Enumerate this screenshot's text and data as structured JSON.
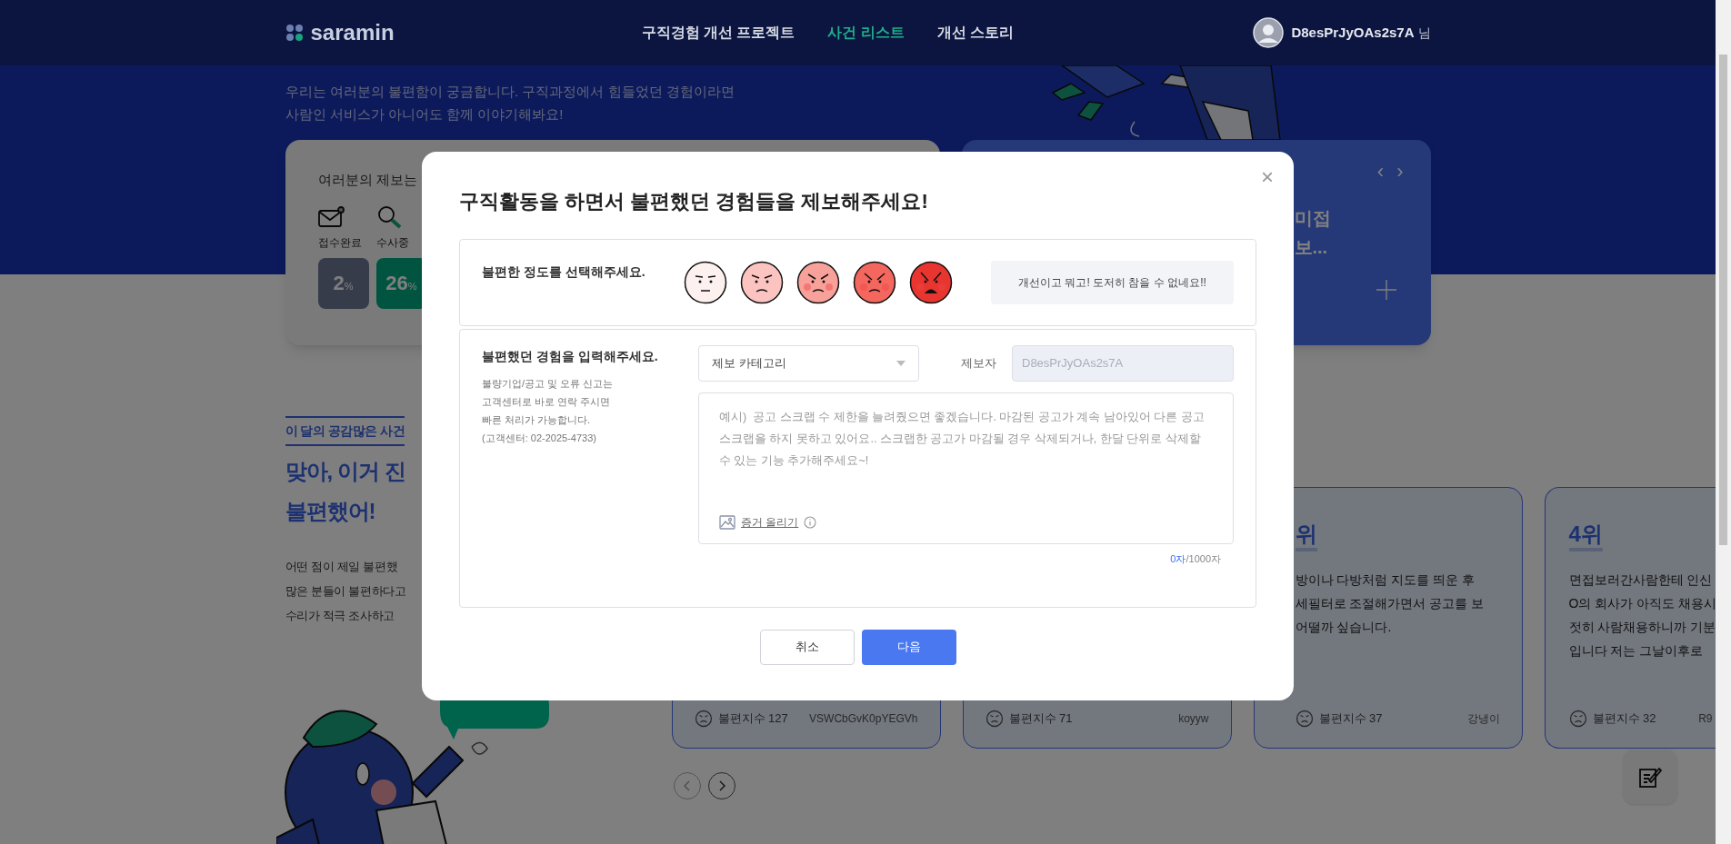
{
  "header": {
    "logo": "saramin",
    "nav": [
      {
        "label": "구직경험 개선 프로젝트",
        "selected": false
      },
      {
        "label": "사건 리스트",
        "selected": true
      },
      {
        "label": "개선 스토리",
        "selected": false
      }
    ],
    "user": {
      "name": "D8esPrJyOAs2s7A",
      "suffix": "님"
    }
  },
  "hero": {
    "lines": [
      "우리는 여러분의 불편함이 궁금합니다. 구직과정에서 힘들었던 경험이라면",
      "사람인 서비스가 아니어도 함께 이야기해봐요!"
    ]
  },
  "report_card": {
    "title": "여러분의 제보는",
    "stats": [
      {
        "kind": "received",
        "label": "접수완료",
        "value": "2",
        "unit": "%"
      },
      {
        "kind": "investigating",
        "label": "수사중",
        "value": "26",
        "unit": "%"
      }
    ]
  },
  "story_card": {
    "prev": "‹",
    "next": "›",
    "title_lines": [
      "미접",
      "보..."
    ]
  },
  "monthly": {
    "tag": "이 달의 공감많은 사건",
    "heading_lines": [
      "맞아, 이거 진",
      "불편했어!"
    ],
    "paragraph_lines": [
      "어떤 점이 제일 불편했",
      "많은 분들이 불편하다고",
      "수리가 적극 조사하고"
    ]
  },
  "cases": [
    {
      "score": "불편지수 127",
      "author": "VSWCbGvK0pYEGVh"
    },
    {
      "score": "불편지수 71",
      "author": "koyyw"
    },
    {
      "rank": "위",
      "lines": [
        "방이나 다방처럼 지도를 띄운 후",
        "세필터로 조절해가면서 공고를 보",
        "어떨까 싶습니다."
      ],
      "score": "불편지수 37",
      "author": "강냉이"
    },
    {
      "rank": "4위",
      "lines": [
        "면접보러간사람한테 인신",
        "O의 회사가 아직도 채용시",
        "젓히 사람채용하니까 기분",
        "입니다 저는 그날이후로"
      ],
      "score": "불편지수 32",
      "author": "R9"
    }
  ],
  "modal": {
    "title": "구직활동을 하면서 불편했던 경험들을 제보해주세요!",
    "close": "×",
    "severity": {
      "label": "불편한 정도를 선택해주세요.",
      "faces": [
        {
          "color": "#fdf1ef"
        },
        {
          "color": "#fcc4c0"
        },
        {
          "color": "#f8a19a"
        },
        {
          "color": "#f4675f"
        },
        {
          "color": "#e8352f"
        }
      ],
      "message": "개선이고 뭐고! 도저히 참을 수 없네요!!"
    },
    "experience": {
      "label": "불편했던 경험을 입력해주세요.",
      "help_lines": [
        "불량기업/공고 및 오류 신고는",
        "고객센터로 바로 연락 주시면",
        "빠른 처리가 가능합니다.",
        "(고객센터: 02-2025-4733)"
      ],
      "category": {
        "placeholder": "제보 카테고리"
      },
      "reporter": {
        "label": "제보자",
        "value": "D8esPrJyOAs2s7A",
        "disabled": true
      },
      "content": {
        "placeholder": "예시)  공고 스크랩 수 제한을 늘려줬으면 좋겠습니다. 마감된 공고가 계속 남아있어 다른 공고 스크랩을 하지 못하고 있어요.. 스크랩한 공고가 마감될 경우 삭제되거나, 한달 단위로 삭제할 수 있는 기능 추가해주세요~!"
      },
      "evidence_link": "증거 올리기",
      "counter": {
        "current": "0자",
        "max": "/1000자"
      }
    },
    "buttons": [
      {
        "kind": "secondary",
        "label": "취소"
      },
      {
        "kind": "primary",
        "label": "다음"
      }
    ]
  }
}
